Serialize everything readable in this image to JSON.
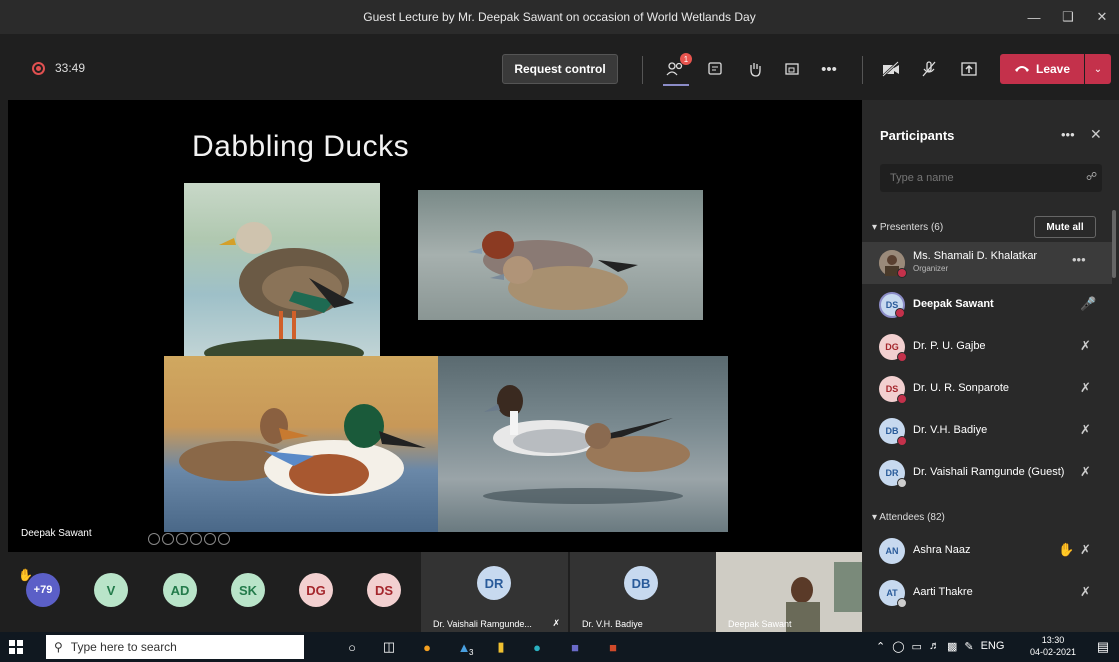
{
  "window": {
    "title": "Guest Lecture by Mr. Deepak Sawant on occasion of World Wetlands Day",
    "minimize_icon": "minimize-icon",
    "restore_icon": "restore-icon",
    "close_icon": "close-icon"
  },
  "toolbar": {
    "timer": "33:49",
    "request_control": "Request control",
    "participants_badge": "1",
    "leave_label": "Leave"
  },
  "slide": {
    "title": "Dabbling Ducks",
    "presenter": "Deepak Sawant"
  },
  "strip": {
    "overflow_count": "+79",
    "avatars": [
      {
        "initials": "V",
        "color": "#b9e4c9"
      },
      {
        "initials": "AD",
        "color": "#b9e4c9"
      },
      {
        "initials": "SK",
        "color": "#b9e4c9"
      },
      {
        "initials": "DG",
        "color": "#f2d0d0"
      },
      {
        "initials": "DS",
        "color": "#f2d0d0"
      }
    ],
    "tiles": [
      {
        "initials": "DR",
        "label": "Dr. Vaishali Ramgunde..."
      },
      {
        "initials": "DB",
        "label": "Dr. V.H. Badiye"
      },
      {
        "label": "Deepak Sawant"
      }
    ]
  },
  "panel": {
    "title": "Participants",
    "search_placeholder": "Type a name",
    "presenters_header": "Presenters (6)",
    "mute_all": "Mute all",
    "attendees_header": "Attendees (82)",
    "presenters": [
      {
        "initials": "",
        "name": "Ms. Shamali D. Khalatkar",
        "role": "Organizer"
      },
      {
        "initials": "DS",
        "name": "Deepak Sawant"
      },
      {
        "initials": "DG",
        "name": "Dr. P. U. Gajbe"
      },
      {
        "initials": "DS",
        "name": "Dr. U. R. Sonparote"
      },
      {
        "initials": "DB",
        "name": "Dr. V.H. Badiye"
      },
      {
        "initials": "DR",
        "name": "Dr. Vaishali Ramgunde (Guest)"
      }
    ],
    "attendees": [
      {
        "initials": "AN",
        "name": "Ashra Naaz"
      },
      {
        "initials": "AT",
        "name": "Aarti Thakre"
      }
    ]
  },
  "taskbar": {
    "search_placeholder": "Type here to search",
    "language": "ENG",
    "time": "13:30",
    "date": "04-02-2021",
    "edge_badge": "3"
  },
  "colors": {
    "leave": "#c4314b",
    "accent": "#8b8cc7",
    "presence_busy": "#c4314b",
    "presence_away": "#cccccc"
  }
}
